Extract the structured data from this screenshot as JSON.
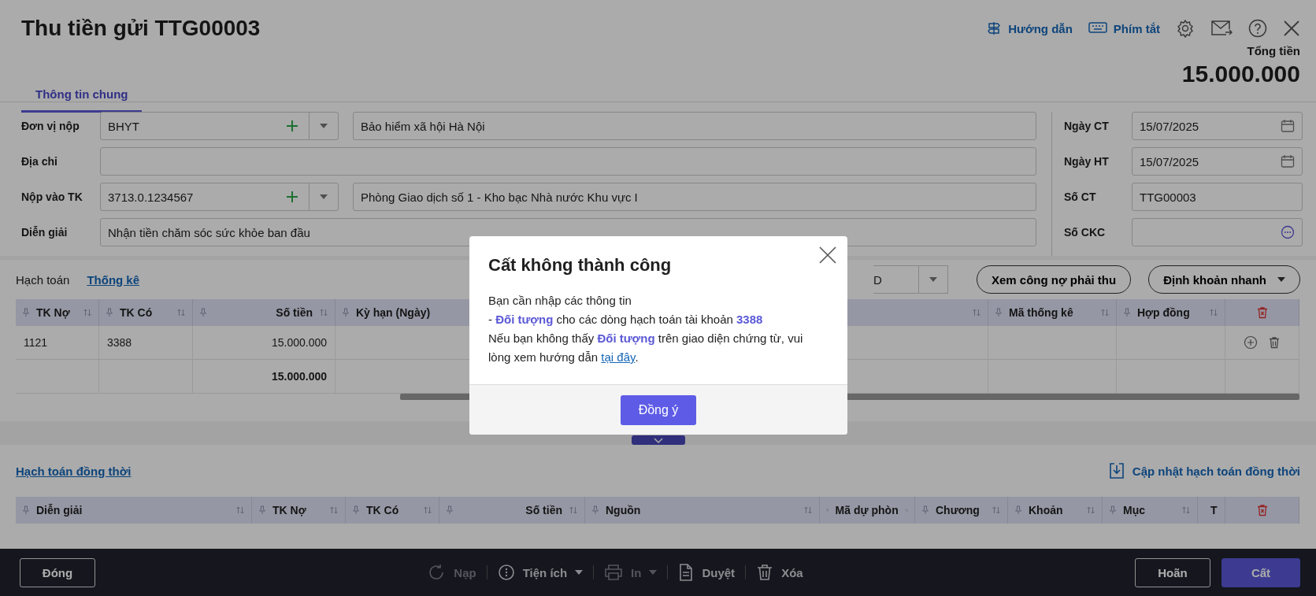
{
  "window": {
    "title": "Thu tiền gửi TTG00003"
  },
  "toolbar": [
    {
      "kind": "guide",
      "label": "Hướng dẫn"
    },
    {
      "kind": "keyboard",
      "label": "Phím tắt"
    }
  ],
  "tabs": [
    {
      "label": "Thông tin chung",
      "selected": true
    }
  ],
  "total": {
    "label": "Tổng tiền",
    "value": "15.000.000"
  },
  "form": {
    "left": [
      {
        "label": "Đơn vị nộp",
        "kind": "lookup",
        "code": "BHYT",
        "name": "Bảo hiểm xã hội Hà Nội"
      },
      {
        "label": "Địa chỉ",
        "kind": "text"
      },
      {
        "label": "Nộp vào TK",
        "kind": "lookup",
        "code": "3713.0.1234567",
        "name": "Phòng Giao dịch số 1 - Kho bạc Nhà nước Khu vực I"
      },
      {
        "label": "Diễn giải",
        "kind": "text",
        "value": "Nhận tiền chăm sóc sức khỏe ban đầu"
      }
    ],
    "right": [
      {
        "label": "Ngày CT",
        "kind": "date",
        "value": "15/07/2025"
      },
      {
        "label": "Ngày HT",
        "kind": "date",
        "value": "15/07/2025"
      },
      {
        "label": "Số CT",
        "kind": "text",
        "value": "TTG00003"
      },
      {
        "label": "Số CKC",
        "kind": "more"
      }
    ]
  },
  "detail_tabs": [
    {
      "label": "Hạch toán",
      "selected": true
    },
    {
      "label": "Thống kê",
      "selected": false
    }
  ],
  "currency": {
    "value": "D"
  },
  "detail_buttons": [
    {
      "label": "Xem công nợ phải thu",
      "kind": "plain"
    },
    {
      "label": "Định khoản nhanh",
      "kind": "dropdown"
    }
  ],
  "table": {
    "columns": [
      {
        "kind": "text",
        "label": "TK Nợ"
      },
      {
        "kind": "text",
        "label": "TK Có"
      },
      {
        "kind": "amount",
        "label": "Số tiền"
      },
      {
        "kind": "covered",
        "label": "Kỳ hạn (Ngày)"
      },
      {
        "kind": "blank"
      },
      {
        "kind": "text",
        "label": "Mã thống kê"
      },
      {
        "kind": "text",
        "label": "Hợp đồng"
      }
    ],
    "rows": [
      {
        "cells": [
          "1121",
          "3388",
          "15.000.000"
        ]
      }
    ],
    "total": "15.000.000"
  },
  "concurrent": {
    "title": "Hạch toán đồng thời",
    "action": "Cập nhật hạch toán đồng thời",
    "columns": [
      {
        "kind": "text",
        "label": "Diễn giải"
      },
      {
        "kind": "text",
        "label": "TK Nợ"
      },
      {
        "kind": "text",
        "label": "TK Có"
      },
      {
        "kind": "amount",
        "label": "Số tiền"
      },
      {
        "kind": "text",
        "label": "Nguồn"
      },
      {
        "kind": "text",
        "label": "Mã dự phòn"
      },
      {
        "kind": "text",
        "label": "Chương"
      },
      {
        "kind": "text",
        "label": "Khoản"
      },
      {
        "kind": "text",
        "label": "Mục"
      },
      {
        "kind": "text",
        "label": "T"
      }
    ]
  },
  "footer": {
    "close": "Đóng",
    "tools": [
      {
        "kind": "reload",
        "label": "Nạp",
        "disabled": true,
        "dropdown": false
      },
      {
        "kind": "utility",
        "label": "Tiện ích",
        "disabled": false,
        "dropdown": true
      },
      {
        "kind": "print",
        "label": "In",
        "disabled": true,
        "dropdown": true
      },
      {
        "kind": "approve",
        "label": "Duyệt",
        "disabled": false,
        "dropdown": false
      },
      {
        "kind": "delete",
        "label": "Xóa",
        "disabled": false,
        "dropdown": false
      }
    ],
    "actions": [
      {
        "kind": "secondary",
        "label": "Hoãn"
      },
      {
        "kind": "primary",
        "label": "Cất"
      }
    ]
  },
  "dialog": {
    "title": "Cất không thành công",
    "lines": [
      "Bạn cần nhập các thông tin",
      "- **Đối tượng** cho các dòng hạch toán tài khoản **3388**"
    ],
    "note": "Nếu bạn không thấy **Đối tượng** trên giao diện chứng từ, vui lòng xem hướng dẫn ",
    "link": "tại đây",
    "note_end": ".",
    "button": "Đồng ý"
  }
}
